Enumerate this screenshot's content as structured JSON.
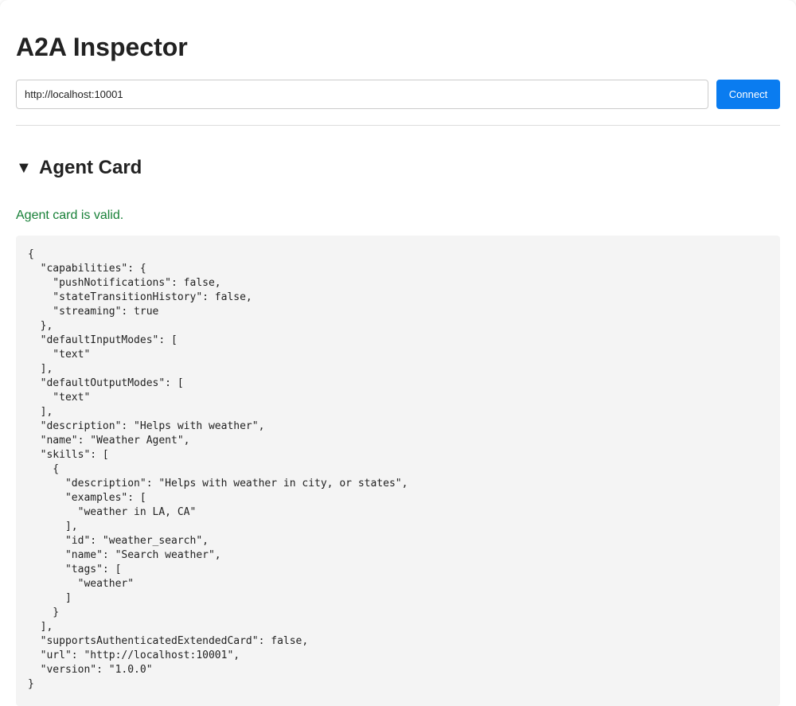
{
  "app": {
    "title": "A2A Inspector"
  },
  "connection": {
    "url_value": "http://localhost:10001",
    "connect_label": "Connect"
  },
  "agent_card": {
    "toggle_icon": "▼",
    "section_title": "Agent Card",
    "status_text": "Agent card is valid.",
    "status_color": "#188038",
    "json_text": "{\n  \"capabilities\": {\n    \"pushNotifications\": false,\n    \"stateTransitionHistory\": false,\n    \"streaming\": true\n  },\n  \"defaultInputModes\": [\n    \"text\"\n  ],\n  \"defaultOutputModes\": [\n    \"text\"\n  ],\n  \"description\": \"Helps with weather\",\n  \"name\": \"Weather Agent\",\n  \"skills\": [\n    {\n      \"description\": \"Helps with weather in city, or states\",\n      \"examples\": [\n        \"weather in LA, CA\"\n      ],\n      \"id\": \"weather_search\",\n      \"name\": \"Search weather\",\n      \"tags\": [\n        \"weather\"\n      ]\n    }\n  ],\n  \"supportsAuthenticatedExtendedCard\": false,\n  \"url\": \"http://localhost:10001\",\n  \"version\": \"1.0.0\"\n}"
  },
  "theme": {
    "accent": "#0a7cf0",
    "code_background": "#f4f4f4"
  }
}
